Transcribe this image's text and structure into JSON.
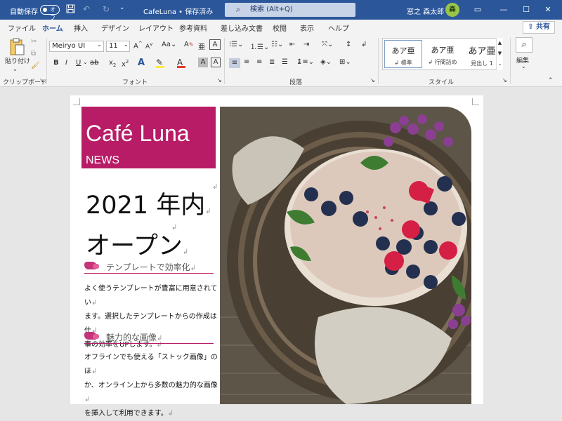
{
  "titlebar": {
    "autosave_label": "自動保存",
    "toggle_label": "オフ",
    "doc_title": "CafeLuna • 保存済み",
    "search_placeholder": "検索 (Alt+Q)",
    "user_name": "窓之 森太郎",
    "avatar_text": "森"
  },
  "menus": [
    "ファイル",
    "ホーム",
    "挿入",
    "デザイン",
    "レイアウト",
    "参考資料",
    "差し込み文書",
    "校閲",
    "表示",
    "ヘルプ"
  ],
  "share_label": "共有",
  "ribbon": {
    "paste_label": "貼り付け",
    "clipboard_group": "クリップボード",
    "font_name": "Meiryo UI",
    "font_size": "11",
    "font_group": "フォント",
    "paragraph_group": "段落",
    "styles": [
      {
        "sample": "あア亜",
        "name": "標準"
      },
      {
        "sample": "あア亜",
        "name": "行間詰め"
      },
      {
        "sample": "あア亜",
        "name": "見出し 1"
      }
    ],
    "styles_group": "スタイル",
    "edit_label": "編集"
  },
  "document": {
    "brand_title": "Café Luna",
    "brand_sub": "NEWS",
    "headline_1": "2021 年内",
    "headline_2": "オープン",
    "section1_heading": "テンプレートで効率化",
    "section1_lines": [
      "よく使うテンプレートが豊富に用意されてい",
      "ます。選択したテンプレートからの作成は仕",
      "事の効率をUPします。"
    ],
    "section2_heading": "魅力的な画像",
    "section2_lines": [
      "オフラインでも使える「ストック画像」のほ",
      "か、オンライン上から多数の魅力的な画像",
      "を挿入して利用できます。"
    ]
  },
  "colors": {
    "word_blue": "#2b579a",
    "accent_magenta": "#b81c66"
  }
}
